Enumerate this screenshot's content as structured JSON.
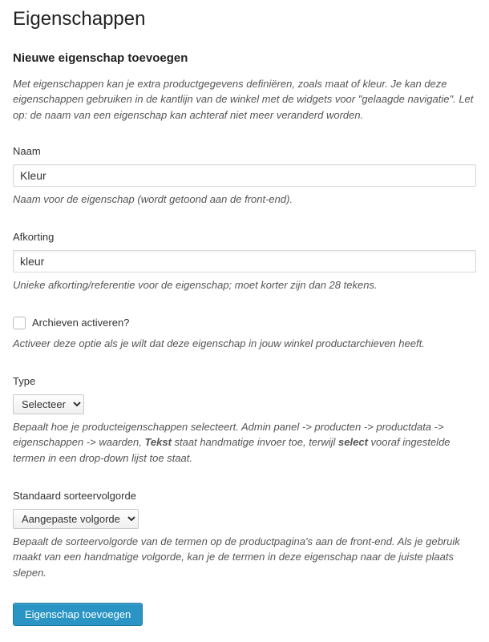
{
  "page": {
    "title": "Eigenschappen"
  },
  "form": {
    "heading": "Nieuwe eigenschap toevoegen",
    "intro": "Met eigenschappen kan je extra productgegevens definiëren, zoals maat of kleur. Je kan deze eigenschappen gebruiken in de kantlijn van de winkel met de widgets voor \"gelaagde navigatie\". Let op: de naam van een eigenschap kan achteraf niet meer veranderd worden.",
    "name": {
      "label": "Naam",
      "value": "Kleur",
      "help": "Naam voor de eigenschap (wordt getoond aan de front-end)."
    },
    "slug": {
      "label": "Afkorting",
      "value": "kleur",
      "help": "Unieke afkorting/referentie voor de eigenschap; moet korter zijn dan 28 tekens."
    },
    "archives": {
      "label": "Archieven activeren?",
      "help": "Activeer deze optie als je wilt dat deze eigenschap in jouw winkel productarchieven heeft."
    },
    "type": {
      "label": "Type",
      "selected": "Selecteer",
      "help_pre": "Bepaalt hoe je producteigenschappen selecteert. Admin panel -> producten -> productdata -> eigenschappen -> waarden, ",
      "help_bold1": "Tekst",
      "help_mid": " staat handmatige invoer toe, terwijl ",
      "help_bold2": "select",
      "help_post": " vooraf ingestelde termen in een drop-down lijst toe staat."
    },
    "order": {
      "label": "Standaard sorteervolgorde",
      "selected": "Aangepaste volgorde",
      "help": "Bepaalt de sorteervolgorde van de termen op de productpagina's aan de front-end. Als je gebruik maakt van een handmatige volgorde, kan je de termen in deze eigenschap naar de juiste plaats slepen."
    },
    "submit": "Eigenschap toevoegen"
  }
}
